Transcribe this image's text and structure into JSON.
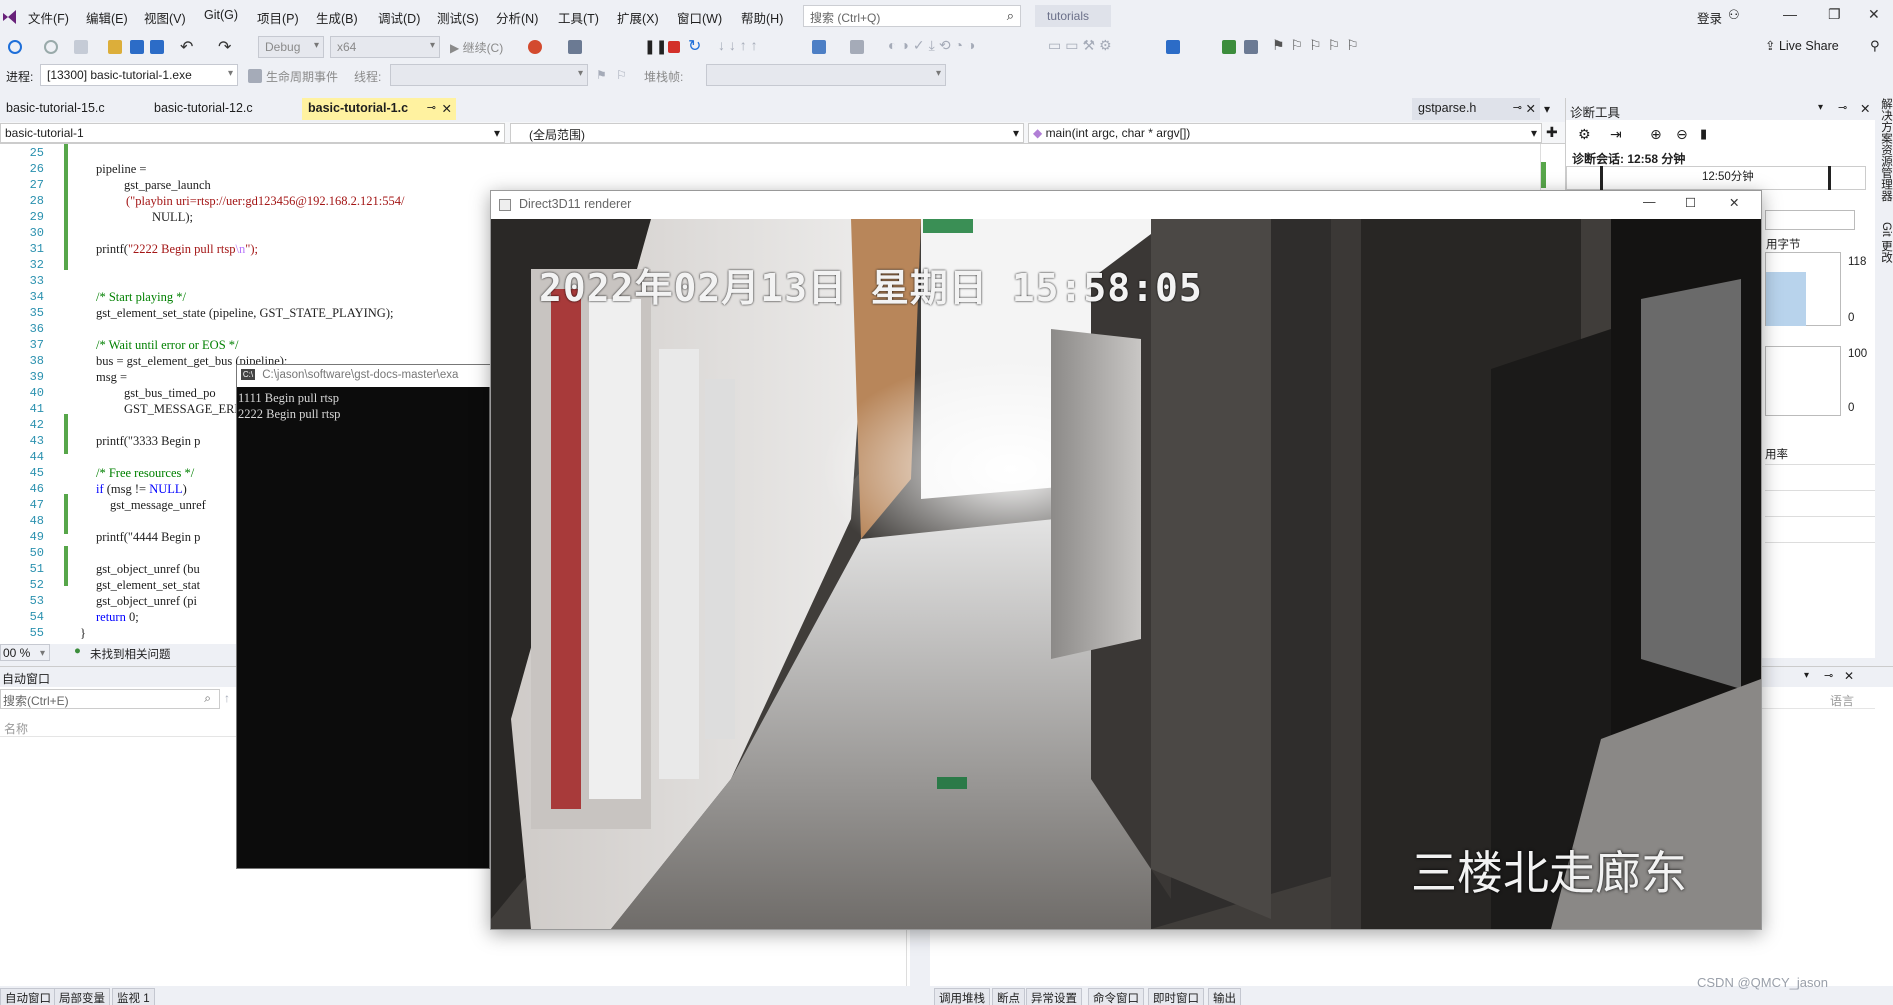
{
  "menu": [
    "文件(F)",
    "编辑(E)",
    "视图(V)",
    "Git(G)",
    "项目(P)",
    "生成(B)",
    "调试(D)",
    "测试(S)",
    "分析(N)",
    "工具(T)",
    "扩展(X)",
    "窗口(W)",
    "帮助(H)"
  ],
  "search": {
    "placeholder": "搜索 (Ctrl+Q)"
  },
  "solution_name": "tutorials",
  "signin": "登录",
  "toolbar": {
    "config": "Debug",
    "platform": "x64",
    "continue": "继续(C)",
    "live_share": "Live Share"
  },
  "toolbar2": {
    "process_label": "进程:",
    "process_value": "[13300] basic-tutorial-1.exe",
    "lifecycle": "生命周期事件",
    "thread": "线程:",
    "stackframe": "堆栈帧:"
  },
  "tabs": [
    "basic-tutorial-15.c",
    "basic-tutorial-12.c",
    "basic-tutorial-1.c",
    "gstparse.h"
  ],
  "navbar": {
    "project": "basic-tutorial-1",
    "scope": "(全局范围)",
    "function": "main(int argc, char * argv[])"
  },
  "code": {
    "line_numbers": [
      "25",
      "26",
      "27",
      "28",
      "29",
      "30",
      "31",
      "32",
      "33",
      "34",
      "35",
      "36",
      "37",
      "38",
      "39",
      "40",
      "41",
      "42",
      "43",
      "44",
      "45",
      "46",
      "47",
      "48",
      "49",
      "50",
      "51",
      "52",
      "53",
      "54",
      "55"
    ],
    "l26": "pipeline =",
    "l27": "gst_parse_launch",
    "l28": "(\"playbin uri=rtsp://uer:gd123456@192.168.2.121:554/",
    "l29": "NULL);",
    "l31a": "printf(",
    "l31b": "\"2222 Begin pull rtsp",
    "l31c": "\\n",
    "l31d": "\");",
    "l34": "/* Start playing */",
    "l35": "gst_element_set_state (pipeline, GST_STATE_PLAYING);",
    "l37": "/* Wait until error or EOS */",
    "l38": "bus = gst_element_get_bus (pipeline);",
    "l39": "msg =",
    "l40": "gst_bus_timed_po",
    "l41": "GST_MESSAGE_ERRO",
    "l43": "printf(\"3333 Begin p",
    "l45": "/* Free resources */",
    "l46a": "if",
    "l46b": " (msg != ",
    "l46c": "NULL",
    "l46d": ")",
    "l47": "gst_message_unref",
    "l49": "printf(\"4444 Begin p",
    "l51": "gst_object_unref (bu",
    "l52": "gst_element_set_stat",
    "l53": "gst_object_unref (pi",
    "l54a": "return",
    "l54b": " 0;",
    "l55": "}"
  },
  "editor_status": {
    "zoom": "00 %",
    "issues": "未找到相关问题"
  },
  "autos": {
    "title": "自动窗口",
    "search": "搜索(Ctrl+E)",
    "col_name": "名称"
  },
  "callstack": {
    "col_lang": "语言"
  },
  "bottom_tabs_left": [
    "自动窗口",
    "局部变量",
    "监视 1"
  ],
  "bottom_tabs_right": [
    "调用堆栈",
    "断点",
    "异常设置",
    "命令窗口",
    "即时窗口",
    "输出"
  ],
  "diag": {
    "title": "诊断工具",
    "session": "诊断会话: 12:58 分钟",
    "time_label": "12:50分钟",
    "mem_label": "用字节",
    "mem_max": "118",
    "mem_min": "0",
    "cpu_max": "100",
    "cpu_min": "0",
    "cpu_label": "用率"
  },
  "right_rail": [
    "解决方案资源管理器",
    "Git 更改"
  ],
  "console": {
    "title": "C:\\jason\\software\\gst-docs-master\\exa",
    "lines": [
      "1111 Begin pull rtsp",
      "2222 Begin pull rtsp"
    ]
  },
  "renderer": {
    "title": "Direct3D11 renderer",
    "cam_time": "2022年02月13日  星期日  15:58:05",
    "cam_name": "三楼北走廊东"
  },
  "watermark": "CSDN @QMCY_jason",
  "colors": {
    "accent": "#fff2a0",
    "chrome": "#eef0f5",
    "console_bg": "#0c0c0c",
    "change_marker": "#57a64a",
    "keyword": "#0000ff",
    "comment": "#008000",
    "string": "#a31515"
  }
}
